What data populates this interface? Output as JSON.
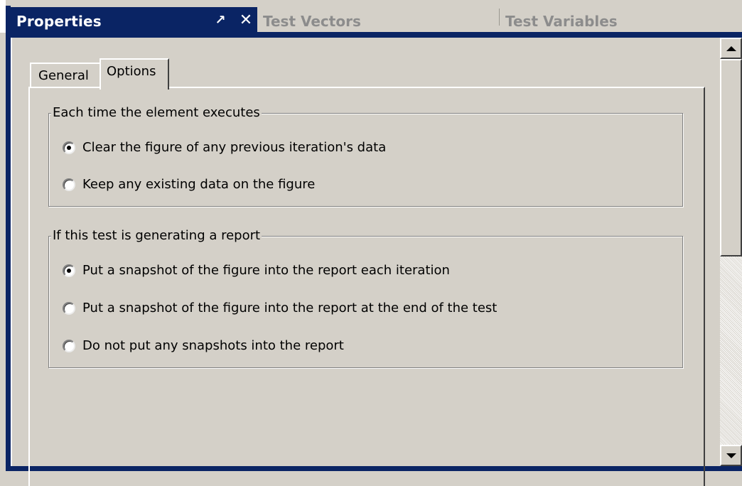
{
  "doc_tabs": [
    {
      "label": "Properties",
      "active": true
    },
    {
      "label": "Test Vectors",
      "active": false
    },
    {
      "label": "Test Variables",
      "active": false
    }
  ],
  "inner_tabs": [
    {
      "label": "General",
      "selected": false
    },
    {
      "label": "Options",
      "selected": true
    }
  ],
  "groups": [
    {
      "title": "Each time the element executes",
      "options": [
        {
          "label": "Clear the figure of any previous iteration's data",
          "checked": true
        },
        {
          "label": "Keep any existing data on the figure",
          "checked": false
        }
      ]
    },
    {
      "title": "If this test is generating a report",
      "options": [
        {
          "label": "Put a snapshot of the figure into the report each iteration",
          "checked": true
        },
        {
          "label": "Put a snapshot of the figure into the report at the end of the test",
          "checked": false
        },
        {
          "label": "Do not put any snapshots into the report",
          "checked": false
        }
      ]
    }
  ],
  "icons": {
    "pin": "pin-icon",
    "close": "close-icon",
    "scroll_up": "arrow-up-icon",
    "scroll_down": "arrow-down-icon"
  },
  "colors": {
    "active_tab": "#0a2464",
    "background": "#d4d0c8",
    "inactive_tab_text": "#8c8c8c"
  }
}
